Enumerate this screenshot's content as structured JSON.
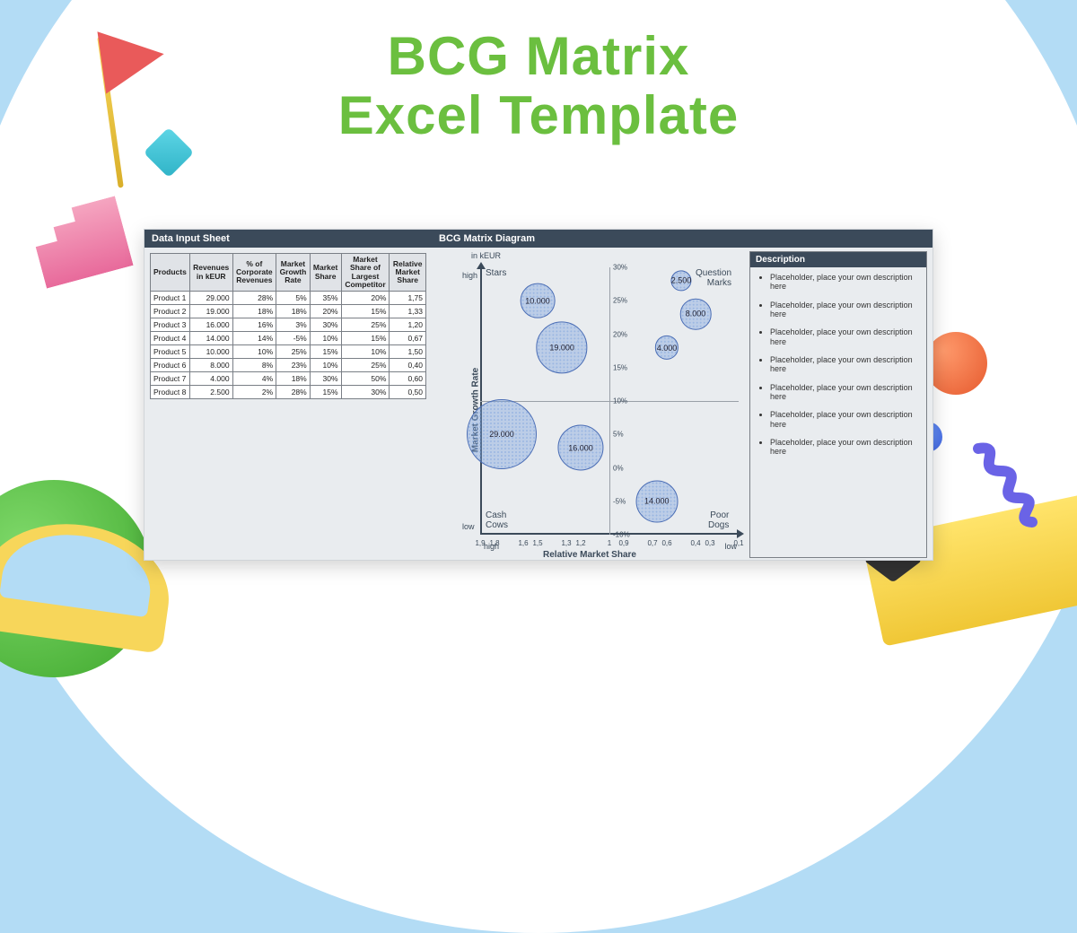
{
  "title_line1": "BCG Matrix",
  "title_line2": "Excel Template",
  "left_panel_title": "Data Input Sheet",
  "right_panel_title": "BCG Matrix Diagram",
  "chart_unit": "in kEUR",
  "table": {
    "headers": [
      "Products",
      "Revenues in kEUR",
      "% of Corporate Revenues",
      "Market Growth Rate",
      "Market Share",
      "Market Share of Largest Competitor",
      "Relative Market Share"
    ],
    "rows": [
      {
        "name": "Product 1",
        "rev": "29.000",
        "pct": "28%",
        "growth": "5%",
        "share": "35%",
        "compet": "20%",
        "rel": "1,75"
      },
      {
        "name": "Product 2",
        "rev": "19.000",
        "pct": "18%",
        "growth": "18%",
        "share": "20%",
        "compet": "15%",
        "rel": "1,33"
      },
      {
        "name": "Product 3",
        "rev": "16.000",
        "pct": "16%",
        "growth": "3%",
        "share": "30%",
        "compet": "25%",
        "rel": "1,20"
      },
      {
        "name": "Product 4",
        "rev": "14.000",
        "pct": "14%",
        "growth": "-5%",
        "share": "10%",
        "compet": "15%",
        "rel": "0,67"
      },
      {
        "name": "Product 5",
        "rev": "10.000",
        "pct": "10%",
        "growth": "25%",
        "share": "15%",
        "compet": "10%",
        "rel": "1,50"
      },
      {
        "name": "Product 6",
        "rev": "8.000",
        "pct": "8%",
        "growth": "23%",
        "share": "10%",
        "compet": "25%",
        "rel": "0,40"
      },
      {
        "name": "Product 7",
        "rev": "4.000",
        "pct": "4%",
        "growth": "18%",
        "share": "30%",
        "compet": "50%",
        "rel": "0,60"
      },
      {
        "name": "Product 8",
        "rev": "2.500",
        "pct": "2%",
        "growth": "28%",
        "share": "15%",
        "compet": "30%",
        "rel": "0,50"
      }
    ]
  },
  "description_title": "Description",
  "description_items": [
    "Placeholder, place your own description here",
    "Placeholder, place your own description here",
    "Placeholder, place your own description here",
    "Placeholder, place your own description here",
    "Placeholder, place your own description here",
    "Placeholder, place your own description here",
    "Placeholder, place your own description here"
  ],
  "quadrants": {
    "tl": "Stars",
    "tr": "Question\nMarks",
    "bl": "Cash\nCows",
    "br": "Poor\nDogs"
  },
  "axis": {
    "y": "Market Growth Rate",
    "x": "Relative Market Share",
    "y_high": "high",
    "y_low": "low",
    "x_high": "high",
    "x_low": "low"
  },
  "chart_data": {
    "type": "scatter",
    "title": "BCG Matrix Diagram",
    "xlabel": "Relative Market Share",
    "ylabel": "Market Growth Rate",
    "xlim": [
      1.9,
      0.1
    ],
    "ylim": [
      -10,
      30
    ],
    "x_ticks": [
      1.9,
      1.8,
      1.6,
      1.5,
      1.3,
      1.2,
      1.0,
      0.9,
      0.7,
      0.6,
      0.4,
      0.3,
      0.1
    ],
    "y_ticks_pct": [
      "-10%",
      "-5%",
      "0%",
      "5%",
      "10%",
      "15%",
      "20%",
      "25%",
      "30%"
    ],
    "x_midline": 1.0,
    "y_midline": 10,
    "size_unit": "Revenues in kEUR",
    "series": [
      {
        "name": "Products",
        "points": [
          {
            "label": "29.000",
            "x": 1.75,
            "y": 5,
            "size": 29000
          },
          {
            "label": "19.000",
            "x": 1.33,
            "y": 18,
            "size": 19000
          },
          {
            "label": "16.000",
            "x": 1.2,
            "y": 3,
            "size": 16000
          },
          {
            "label": "14.000",
            "x": 0.67,
            "y": -5,
            "size": 14000
          },
          {
            "label": "10.000",
            "x": 1.5,
            "y": 25,
            "size": 10000
          },
          {
            "label": "8.000",
            "x": 0.4,
            "y": 23,
            "size": 8000
          },
          {
            "label": "4.000",
            "x": 0.6,
            "y": 18,
            "size": 4000
          },
          {
            "label": "2.500",
            "x": 0.5,
            "y": 28,
            "size": 2500
          }
        ]
      }
    ]
  }
}
